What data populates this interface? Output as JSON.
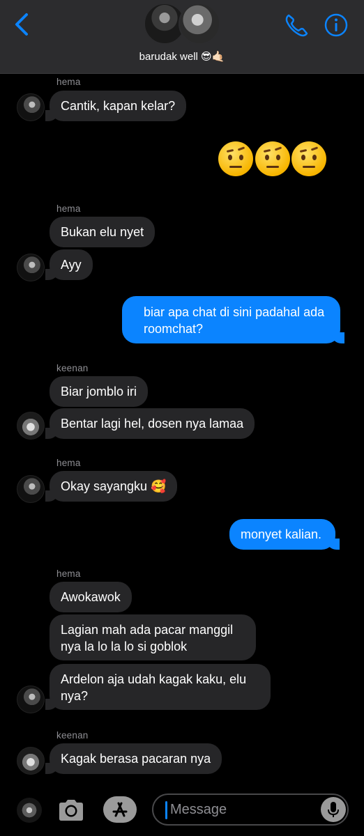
{
  "header": {
    "back_icon": "chevron-left-icon",
    "group_name": "barudak well 😎🤙🏻",
    "call_icon": "phone-icon",
    "info_icon": "info-icon",
    "accent_color": "#0b84ff"
  },
  "messages": [
    {
      "sender": "hema",
      "text": "Cantik, kapan kelar?"
    },
    {
      "emoji": "🤨🤨🤨"
    },
    {
      "sender": "hema",
      "text": "Bukan elu nyet"
    },
    {
      "text": "Ayy"
    },
    {
      "outgoing": true,
      "text": "biar apa chat di sini padahal ada roomchat?"
    },
    {
      "sender": "keenan",
      "text": "Biar jomblo iri"
    },
    {
      "text": "Bentar lagi hel, dosen nya lamaa"
    },
    {
      "sender": "hema",
      "text": "Okay sayangku 🥰"
    },
    {
      "outgoing": true,
      "text": "monyet kalian."
    },
    {
      "sender": "hema",
      "text": "Awokawok"
    },
    {
      "text": "Lagian mah ada pacar manggil nya la lo la lo si goblok"
    },
    {
      "text": "Ardelon aja udah kagak kaku, elu nya?"
    },
    {
      "sender": "keenan",
      "text": "Kagak berasa pacaran nya"
    }
  ],
  "composer": {
    "placeholder": "Message",
    "camera_icon": "camera-icon",
    "apps_icon": "app-store-icon",
    "mic_icon": "microphone-icon"
  }
}
